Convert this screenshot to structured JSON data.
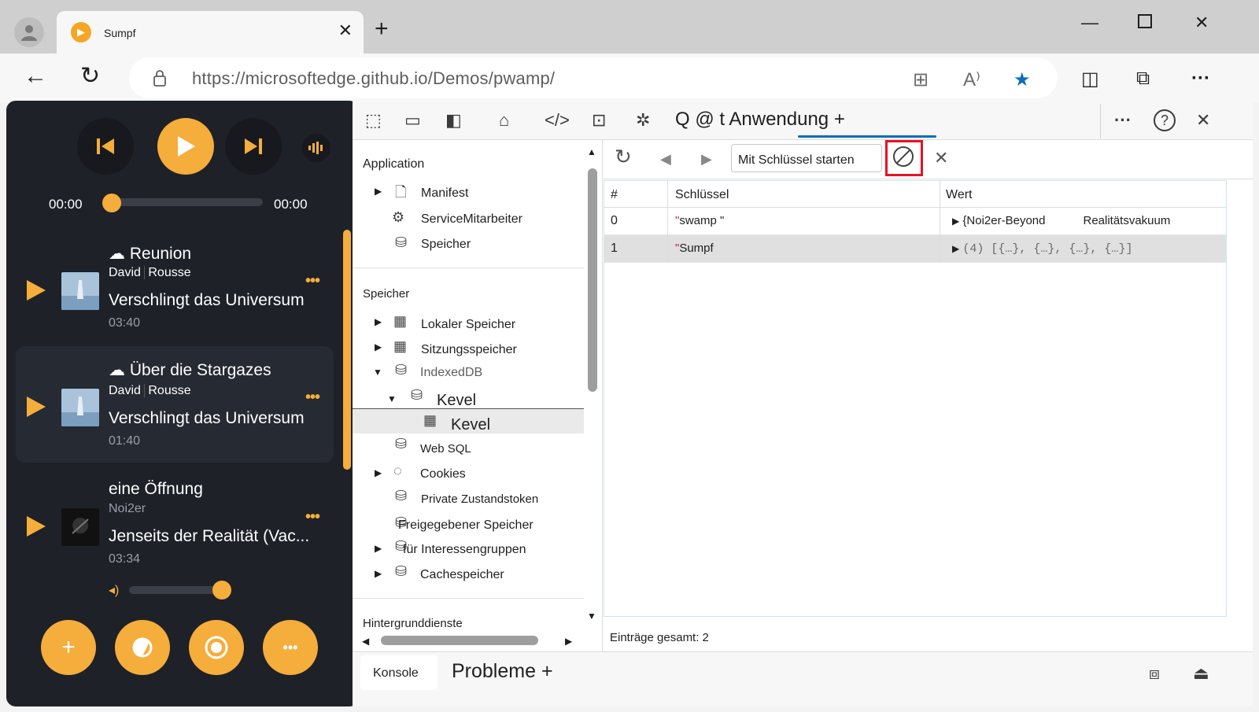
{
  "browser": {
    "tab_title": "Sumpf",
    "new_tab": "+",
    "url_host": "https://microsoftedge.github.io",
    "url_path": "/Demos/pwamp/",
    "favorite_color": "#0f6cbd"
  },
  "player": {
    "time_current": "00:00",
    "time_total": "00:00",
    "accent": "#f5ad3b",
    "songs": [
      {
        "title": "Reunion",
        "cloud": true,
        "artist_first": "David",
        "artist_last": "Rousse",
        "album": "Verschlingt das Universum",
        "duration": "03:40"
      },
      {
        "title": "Über die Stargazes",
        "cloud": true,
        "artist_first": "David",
        "artist_last": "Rousse",
        "album": "Verschlingt das Universum",
        "duration": "01:40"
      },
      {
        "title": "eine Öffnung",
        "cloud": false,
        "artist": "Noi2er",
        "album": "Jenseits der Realität (Vac...",
        "duration": "03:34"
      }
    ],
    "more_label": "•••"
  },
  "devtools": {
    "panel_title": "Q @ t Anwendung +",
    "tree": {
      "application_header": "Application",
      "manifest": "Manifest",
      "service_workers": "ServiceMitarbeiter",
      "storage_item": "Speicher",
      "storage_header": "Speicher",
      "local_storage": "Lokaler Speicher",
      "session_storage": "Sitzungsspeicher",
      "indexeddb": "IndexedDB",
      "db_name": "Kevel",
      "store_name": "Kevel",
      "web_sql": "Web SQL",
      "cookies": "Cookies",
      "private_tokens": "Private Zustandstoken",
      "shared_storage": "Freigegebener Speicher",
      "interest_groups": "für Interessengruppen",
      "cache_storage": "Cachespeicher",
      "background_header": "Hintergrunddienste"
    },
    "filter_placeholder": "Mit Schlüssel starten",
    "columns": [
      "#",
      "Schlüssel",
      "Wert"
    ],
    "rows": [
      {
        "index": "0",
        "key": "swamp \"",
        "value": "{Noi2er-Beyond",
        "value2": "Realitätsvakuum"
      },
      {
        "index": "1",
        "key": "Sumpf",
        "value": "(4) [{…}, {…}, {…}, {…}]"
      }
    ],
    "total_entries": "Einträge gesamt: 2",
    "drawer": {
      "console": "Konsole",
      "problems": "Probleme +"
    }
  }
}
